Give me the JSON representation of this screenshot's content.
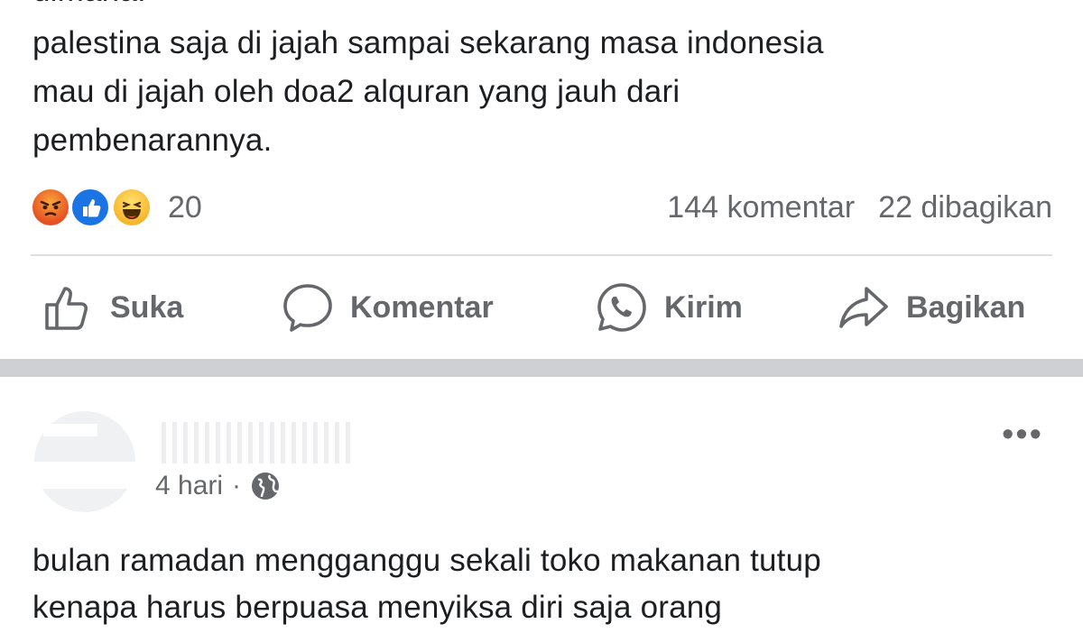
{
  "post1": {
    "text_lines": [
      "dimana.",
      "palestina saja di jajah sampai sekarang masa indonesia",
      "mau di jajah oleh doa2 alquran yang jauh dari",
      "pembenarannya."
    ],
    "reactions": {
      "icons": [
        "angry-icon",
        "like-icon",
        "haha-icon"
      ],
      "count": "20"
    },
    "stats": {
      "comments": "144 komentar",
      "shares": "22 dibagikan"
    },
    "actions": {
      "like": "Suka",
      "comment": "Komentar",
      "send": "Kirim",
      "share": "Bagikan"
    }
  },
  "post2": {
    "time": "4 hari",
    "separator": "·",
    "privacy_icon": "globe-icon",
    "text_lines": [
      "bulan ramadan mengganggu sekali toko makanan tutup",
      "kenapa harus berpuasa menyiksa diri saja orang"
    ]
  },
  "colors": {
    "text": "#1c1e21",
    "secondary": "#65676b",
    "like_blue": "#1b74e4",
    "separator": "#ced0d4"
  }
}
